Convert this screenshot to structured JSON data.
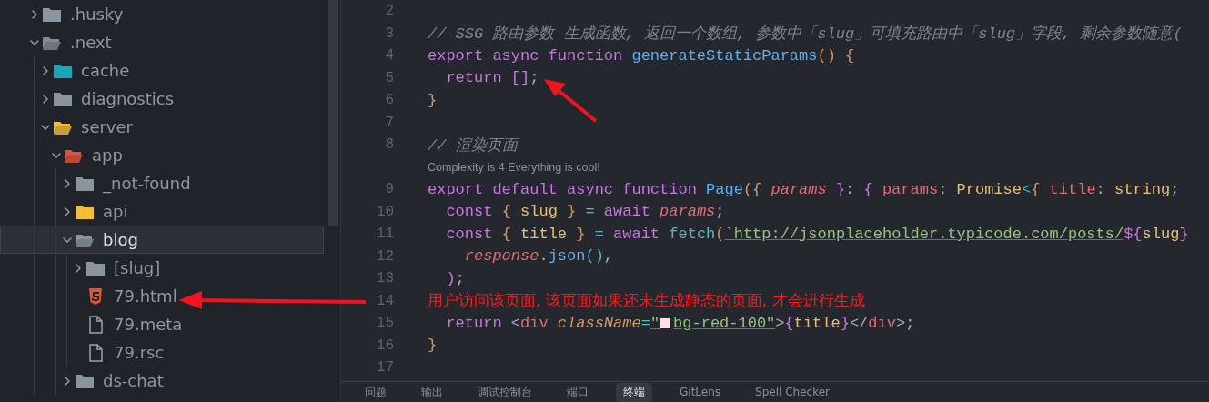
{
  "explorer": {
    "items": [
      {
        "label": ".husky",
        "kind": "folder",
        "expanded": false,
        "selected": false,
        "color": "#8a96a3"
      },
      {
        "label": ".next",
        "kind": "folder",
        "expanded": true,
        "selected": false,
        "color": "#7f8b96",
        "children": [
          {
            "label": "cache",
            "kind": "folder",
            "expanded": false,
            "selected": false,
            "color": "#1ba6b8"
          },
          {
            "label": "diagnostics",
            "kind": "folder",
            "expanded": false,
            "selected": false,
            "color": "#8a949e"
          },
          {
            "label": "server",
            "kind": "folder",
            "expanded": true,
            "selected": false,
            "color": "#f2bd3a",
            "children": [
              {
                "label": "app",
                "kind": "folder",
                "expanded": true,
                "selected": false,
                "color": "#e0533c",
                "children": [
                  {
                    "label": "_not-found",
                    "kind": "folder",
                    "expanded": false,
                    "selected": false,
                    "color": "#8a949e"
                  },
                  {
                    "label": "api",
                    "kind": "folder",
                    "expanded": false,
                    "selected": false,
                    "color": "#f2bd3a"
                  },
                  {
                    "label": "blog",
                    "kind": "folder",
                    "expanded": true,
                    "selected": true,
                    "color": "#8a949e",
                    "children": [
                      {
                        "label": "[slug]",
                        "kind": "folder",
                        "expanded": false,
                        "selected": false,
                        "color": "#8a949e"
                      },
                      {
                        "label": "79.html",
                        "kind": "html",
                        "selected": false
                      },
                      {
                        "label": "79.meta",
                        "kind": "file",
                        "selected": false
                      },
                      {
                        "label": "79.rsc",
                        "kind": "file",
                        "selected": false
                      }
                    ]
                  },
                  {
                    "label": "ds-chat",
                    "kind": "folder",
                    "expanded": false,
                    "selected": false,
                    "color": "#8a949e"
                  }
                ]
              }
            ]
          }
        ]
      }
    ]
  },
  "editor": {
    "lines": [
      {
        "number": "2"
      },
      {
        "number": "3",
        "tokens": [
          {
            "kind": "cm",
            "text": "// SSG 路由参数 生成函数, 返回一个数组, 参数中「slug」可填充路由中「slug」字段, 剩余参数随意("
          }
        ]
      },
      {
        "number": "4",
        "tokens": [
          {
            "kind": "kw",
            "text": "export async function "
          },
          {
            "kind": "fn",
            "text": "generateStaticParams"
          },
          {
            "kind": "br",
            "text": "() {"
          }
        ]
      },
      {
        "number": "5",
        "tokens": [
          {
            "kind": "kw",
            "text": "  return []"
          },
          {
            "kind": "punc",
            "text": ";"
          }
        ]
      },
      {
        "number": "6",
        "tokens": [
          {
            "kind": "br",
            "text": "}"
          }
        ]
      },
      {
        "number": "7"
      },
      {
        "number": "8",
        "tokens": [
          {
            "kind": "cm",
            "text": "// 渲染页面"
          }
        ],
        "lens": "Complexity is 4 Everything is cool!"
      },
      {
        "number": "9",
        "tokens": [
          {
            "kind": "kw",
            "text": "export default async function "
          },
          {
            "kind": "fn",
            "text": "Page"
          },
          {
            "kind": "br",
            "text": "({ "
          },
          {
            "kind": "param",
            "text": "params"
          },
          {
            "kind": "kw",
            "text": " }"
          },
          {
            "kind": "punc",
            "text": ": "
          },
          {
            "kind": "kw",
            "text": "{ "
          },
          {
            "kind": "prop",
            "text": "params"
          },
          {
            "kind": "punc",
            "text": ": "
          },
          {
            "kind": "type",
            "text": "Promise"
          },
          {
            "kind": "call",
            "text": "<"
          },
          {
            "kind": "br",
            "text": "{ "
          },
          {
            "kind": "prop",
            "text": "title"
          },
          {
            "kind": "punc",
            "text": ": "
          },
          {
            "kind": "type",
            "text": "string"
          },
          {
            "kind": "punc",
            "text": ";"
          }
        ]
      },
      {
        "number": "10",
        "tokens": [
          {
            "kind": "kw",
            "text": "  const "
          },
          {
            "kind": "br",
            "text": "{ "
          },
          {
            "kind": "var",
            "text": "slug"
          },
          {
            "kind": "br",
            "text": " }"
          },
          {
            "kind": "call",
            "text": " = "
          },
          {
            "kind": "kw",
            "text": "await "
          },
          {
            "kind": "param",
            "text": "params"
          },
          {
            "kind": "punc",
            "text": ";"
          }
        ]
      },
      {
        "number": "11",
        "tokens": [
          {
            "kind": "kw",
            "text": "  const "
          },
          {
            "kind": "br",
            "text": "{ "
          },
          {
            "kind": "var",
            "text": "title"
          },
          {
            "kind": "br",
            "text": " }"
          },
          {
            "kind": "call",
            "text": " = "
          },
          {
            "kind": "kw",
            "text": "await "
          },
          {
            "kind": "call",
            "text": "fetch"
          },
          {
            "kind": "br",
            "text": "("
          },
          {
            "kind": "str",
            "text": "`http://jsonplaceholder.typicode.com/posts/"
          },
          {
            "kind": "kw",
            "text": "${"
          },
          {
            "kind": "var",
            "text": "slug"
          },
          {
            "kind": "kw",
            "text": "}"
          }
        ]
      },
      {
        "number": "12",
        "tokens": [
          {
            "kind": "param",
            "text": "    response"
          },
          {
            "kind": "punc",
            "text": "."
          },
          {
            "kind": "fn",
            "text": "json"
          },
          {
            "kind": "call",
            "text": "()"
          },
          {
            "kind": "punc",
            "text": ","
          }
        ]
      },
      {
        "number": "13",
        "tokens": [
          {
            "kind": "kw",
            "text": "  )"
          },
          {
            "kind": "punc",
            "text": ";"
          }
        ]
      },
      {
        "number": "14",
        "annotation": "用户访问该页面, 该页面如果还未生成静态的页面, 才会进行生成"
      },
      {
        "number": "15",
        "tokens": [
          {
            "kind": "kw",
            "text": "  return "
          },
          {
            "kind": "punc",
            "text": "<"
          },
          {
            "kind": "tag",
            "text": "div"
          },
          {
            "kind": "attr",
            "text": " className"
          },
          {
            "kind": "call",
            "text": "="
          },
          {
            "kind": "str",
            "text": "\""
          },
          {
            "kind": "swatch",
            "color": "#fee2e2"
          },
          {
            "kind": "str",
            "text": "bg-red-100\""
          },
          {
            "kind": "punc",
            "text": ">"
          },
          {
            "kind": "kw",
            "text": "{"
          },
          {
            "kind": "var",
            "text": "title"
          },
          {
            "kind": "kw",
            "text": "}"
          },
          {
            "kind": "punc",
            "text": "</"
          },
          {
            "kind": "tag",
            "text": "div"
          },
          {
            "kind": "punc",
            "text": ">;"
          }
        ]
      },
      {
        "number": "16",
        "tokens": [
          {
            "kind": "br",
            "text": "}"
          }
        ]
      },
      {
        "number": "17"
      }
    ]
  },
  "panel": {
    "tabs": [
      {
        "label": "问题",
        "selected": false
      },
      {
        "label": "输出",
        "selected": false
      },
      {
        "label": "调试控制台",
        "selected": false
      },
      {
        "label": "端口",
        "selected": false
      },
      {
        "label": "终端",
        "selected": true
      },
      {
        "label": "GitLens",
        "selected": false
      },
      {
        "label": "Spell Checker",
        "selected": false
      }
    ]
  }
}
